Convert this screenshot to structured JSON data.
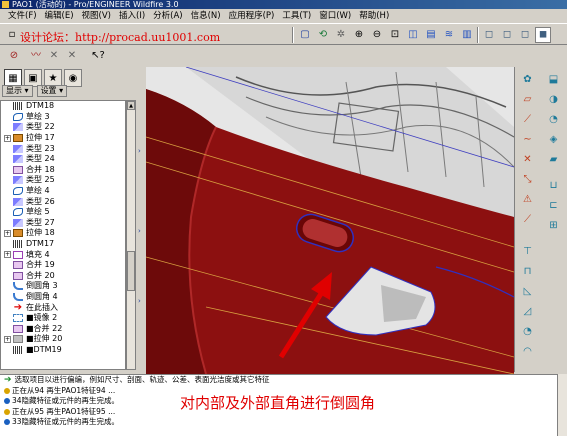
{
  "window": {
    "title": "PAO1 (活动的) - Pro/ENGINEER Wildfire 3.0"
  },
  "menubar": {
    "items": [
      "文件(F)",
      "编辑(E)",
      "视图(V)",
      "插入(I)",
      "分析(A)",
      "信息(N)",
      "应用程序(P)",
      "工具(T)",
      "窗口(W)",
      "帮助(H)"
    ]
  },
  "toolbar": {
    "watermark": "设计论坛：http://procad.uu1001.com"
  },
  "model_tree": {
    "show_label": "显示 ▾",
    "settings_label": "设置 ▾",
    "items": [
      {
        "label": "DTM18",
        "icon": "datum-plane-icon",
        "expand": false
      },
      {
        "label": "草绘 3",
        "icon": "sketch-icon",
        "expand": false
      },
      {
        "label": "类型 22",
        "icon": "type-icon",
        "expand": false
      },
      {
        "label": "拉伸 17",
        "icon": "extrude-icon",
        "expand": true
      },
      {
        "label": "类型 23",
        "icon": "type-icon",
        "expand": false
      },
      {
        "label": "类型 24",
        "icon": "type-icon",
        "expand": false
      },
      {
        "label": "合并 18",
        "icon": "merge-icon",
        "expand": false
      },
      {
        "label": "类型 25",
        "icon": "type-icon",
        "expand": false
      },
      {
        "label": "草绘 4",
        "icon": "sketch-icon",
        "expand": false
      },
      {
        "label": "类型 26",
        "icon": "type-icon",
        "expand": false
      },
      {
        "label": "草绘 5",
        "icon": "sketch-icon",
        "expand": false
      },
      {
        "label": "类型 27",
        "icon": "type-icon",
        "expand": false
      },
      {
        "label": "拉伸 18",
        "icon": "extrude-icon",
        "expand": true
      },
      {
        "label": "DTM17",
        "icon": "datum-plane-icon",
        "expand": false
      },
      {
        "label": "填充 4",
        "icon": "fill-icon",
        "expand": true
      },
      {
        "label": "合并 19",
        "icon": "merge-icon",
        "expand": false
      },
      {
        "label": "合并 20",
        "icon": "merge-icon",
        "expand": false
      },
      {
        "label": "倒圆角 3",
        "icon": "round-icon",
        "expand": false
      },
      {
        "label": "倒圆角 4",
        "icon": "round-icon",
        "expand": false
      },
      {
        "label": "在此插入",
        "icon": "insert-arrow-icon",
        "expand": false
      },
      {
        "label": "■镜像 2",
        "icon": "mirror-icon",
        "expand": false
      },
      {
        "label": "■合并 22",
        "icon": "merge-icon",
        "expand": false
      },
      {
        "label": "■拉伸 20",
        "icon": "hidden-extrude-icon",
        "expand": true
      },
      {
        "label": "■DTM19",
        "icon": "datum-plane-icon",
        "expand": false
      }
    ]
  },
  "messages": {
    "prompt": "选取项目以进行偏编，例如尺寸、剖面、轨迹、公差、表面光洁度或其它特征",
    "lines": [
      {
        "text": "正在从94 再生PAO1特征94 ...",
        "color": "#d9a400"
      },
      {
        "text": "34隐藏特征或元件的再生完成。",
        "color": "#1a60c0"
      },
      {
        "text": "正在从95 再生PAO1特征95 ...",
        "color": "#d9a400"
      },
      {
        "text": "33隐藏特征或元件的再生完成。",
        "color": "#1a60c0"
      }
    ]
  },
  "annotation": {
    "text": "对内部及外部直角进行倒圆角"
  },
  "colors": {
    "part": "#8c1010",
    "part_dark": "#5a0808",
    "arrow": "#e00000"
  }
}
